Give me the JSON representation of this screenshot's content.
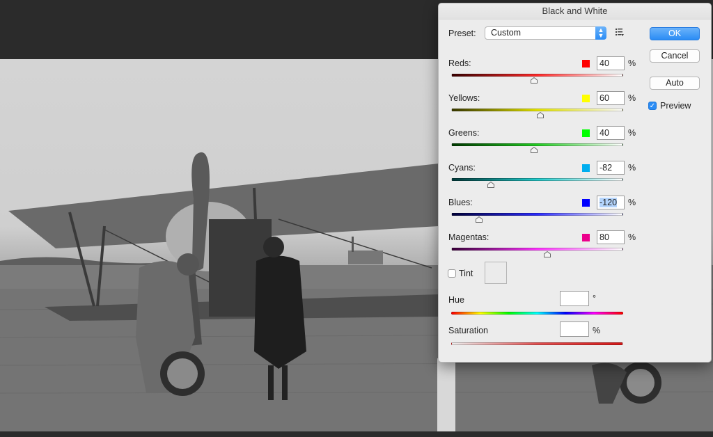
{
  "dialog": {
    "title": "Black and White",
    "preset": {
      "label": "Preset:",
      "value": "Custom"
    },
    "buttons": {
      "ok": "OK",
      "cancel": "Cancel",
      "auto": "Auto"
    },
    "preview": {
      "label": "Preview",
      "checked": true
    },
    "percent_symbol": "%",
    "degree_symbol": "°",
    "colors": [
      {
        "label": "Reds:",
        "value": "40",
        "swatch": "#ff0000",
        "gradient": [
          "#3a0000",
          "#ff2a2a",
          "#ffffff"
        ],
        "slider_fraction": 0.48
      },
      {
        "label": "Yellows:",
        "value": "60",
        "swatch": "#ffff00",
        "gradient": [
          "#3a3a00",
          "#e6e600",
          "#ffffff"
        ],
        "slider_fraction": 0.52
      },
      {
        "label": "Greens:",
        "value": "40",
        "swatch": "#00ff00",
        "gradient": [
          "#003a00",
          "#22cc22",
          "#ffffff"
        ],
        "slider_fraction": 0.48
      },
      {
        "label": "Cyans:",
        "value": "-82",
        "swatch": "#00aeef",
        "gradient": [
          "#003a3a",
          "#22cccc",
          "#ffffff"
        ],
        "slider_fraction": 0.23
      },
      {
        "label": "Blues:",
        "value": "-120",
        "swatch": "#0000ff",
        "gradient": [
          "#00003a",
          "#2a2aff",
          "#ffffff"
        ],
        "slider_fraction": 0.16,
        "selected": true
      },
      {
        "label": "Magentas:",
        "value": "80",
        "swatch": "#ec008c",
        "gradient": [
          "#3a003a",
          "#ff33ff",
          "#ffffff"
        ],
        "slider_fraction": 0.56
      }
    ],
    "tint": {
      "label": "Tint",
      "checked": false
    },
    "hue": {
      "label": "Hue",
      "value": ""
    },
    "saturation": {
      "label": "Saturation",
      "value": ""
    }
  }
}
